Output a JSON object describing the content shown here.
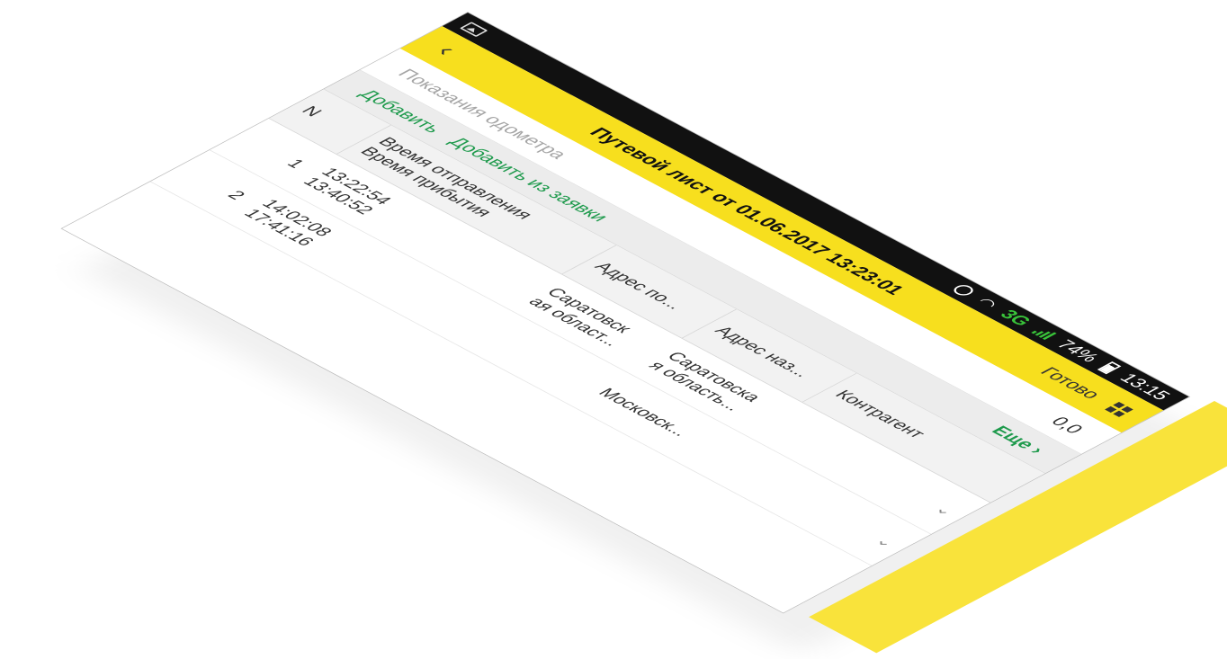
{
  "status_bar": {
    "network": "3G",
    "battery": "74%",
    "time": "13:15"
  },
  "header": {
    "title": "Путевой лист от 01.06.2017 13:23:01",
    "done_label": "Готово"
  },
  "odometer": {
    "label": "Показания одометра",
    "value": "0,0"
  },
  "command_bar": {
    "add_label": "Добавить",
    "add_from_request_label": "Добавить из заявки",
    "more_label": "Еще"
  },
  "table": {
    "columns": {
      "n": "N",
      "departure_time": "Время отправления",
      "arrival_time": "Время прибытия",
      "departure_address": "Адрес по...",
      "destination_address": "Адрес наз...",
      "counterparty": "Контрагент"
    },
    "rows": [
      {
        "n": "1",
        "departure_time": "13:22:54",
        "arrival_time": "13:40:52",
        "departure_address_line1": "Саратовск",
        "departure_address_line2": "ая област...",
        "destination_address_line1": "Саратовска",
        "destination_address_line2": "я область...",
        "counterparty": ""
      },
      {
        "n": "2",
        "departure_time": "14:02:08",
        "arrival_time": "17:41:16",
        "departure_address_line1": "",
        "departure_address_line2": "",
        "destination_address_line1": "Московск...",
        "destination_address_line2": "",
        "counterparty": ""
      }
    ]
  }
}
